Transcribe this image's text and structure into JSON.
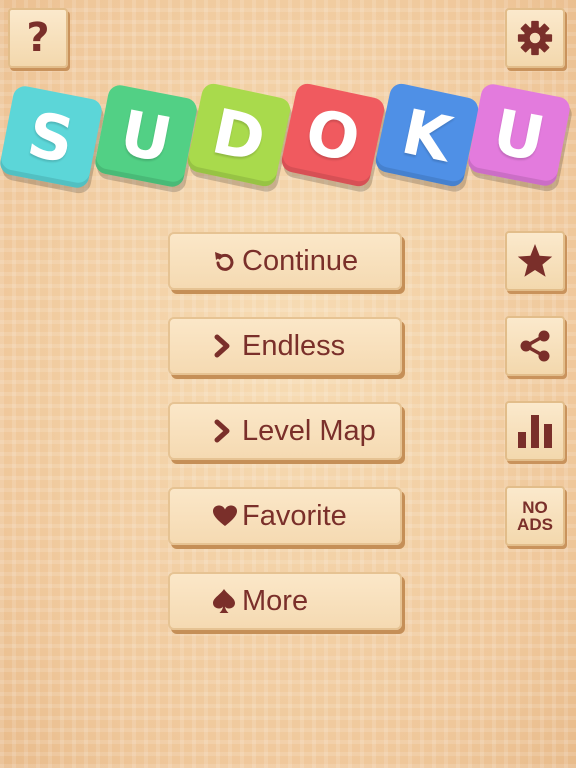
{
  "title": {
    "letters": [
      "S",
      "U",
      "D",
      "O",
      "K",
      "U"
    ],
    "colors": [
      "#5cd6d8",
      "#52d085",
      "#a9da4c",
      "#f05a5f",
      "#4f90e6",
      "#e37bdd"
    ]
  },
  "top_bar": {
    "help_label": "?",
    "help_icon": "question-mark-icon",
    "settings_icon": "gear-icon"
  },
  "menu": {
    "continue": {
      "label": "Continue",
      "icon": "refresh-icon"
    },
    "endless": {
      "label": "Endless",
      "icon": "chevron-right-icon"
    },
    "level_map": {
      "label": "Level Map",
      "icon": "chevron-right-icon"
    },
    "favorite": {
      "label": "Favorite",
      "icon": "heart-icon"
    },
    "more": {
      "label": "More",
      "icon": "spade-icon"
    }
  },
  "side_bar": {
    "rate_icon": "star-icon",
    "share_icon": "share-icon",
    "stats_icon": "bar-chart-icon",
    "no_ads_line1": "NO",
    "no_ads_line2": "ADS"
  },
  "colors": {
    "text": "#7a2f2a",
    "button_bg": "#f7dfbb",
    "background": "#f2d3a8"
  }
}
